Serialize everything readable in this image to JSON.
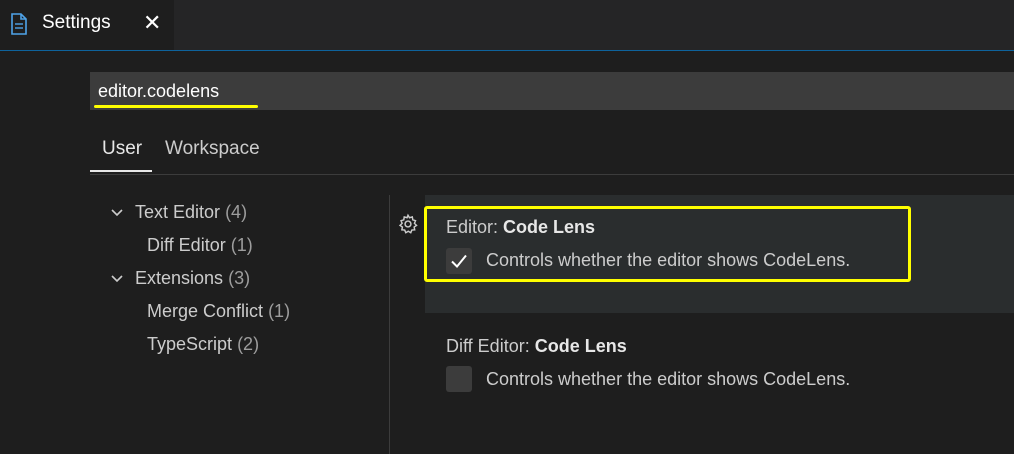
{
  "tab": {
    "label": "Settings",
    "close": "✕"
  },
  "search": {
    "value": "editor.codelens"
  },
  "scopes": {
    "user": "User",
    "workspace": "Workspace"
  },
  "toc": [
    {
      "label": "Text Editor",
      "count": "(4)"
    },
    {
      "label": "Diff Editor",
      "count": "(1)"
    },
    {
      "label": "Extensions",
      "count": "(3)"
    },
    {
      "label": "Merge Conflict",
      "count": "(1)"
    },
    {
      "label": "TypeScript",
      "count": "(2)"
    }
  ],
  "settings": [
    {
      "category": "Editor: ",
      "name": "Code Lens",
      "description": "Controls whether the editor shows CodeLens.",
      "checked": true
    },
    {
      "category": "Diff Editor: ",
      "name": "Code Lens",
      "description": "Controls whether the editor shows CodeLens.",
      "checked": false
    }
  ],
  "colors": {
    "highlight": "#ffff00",
    "accent": "#0e639c"
  }
}
